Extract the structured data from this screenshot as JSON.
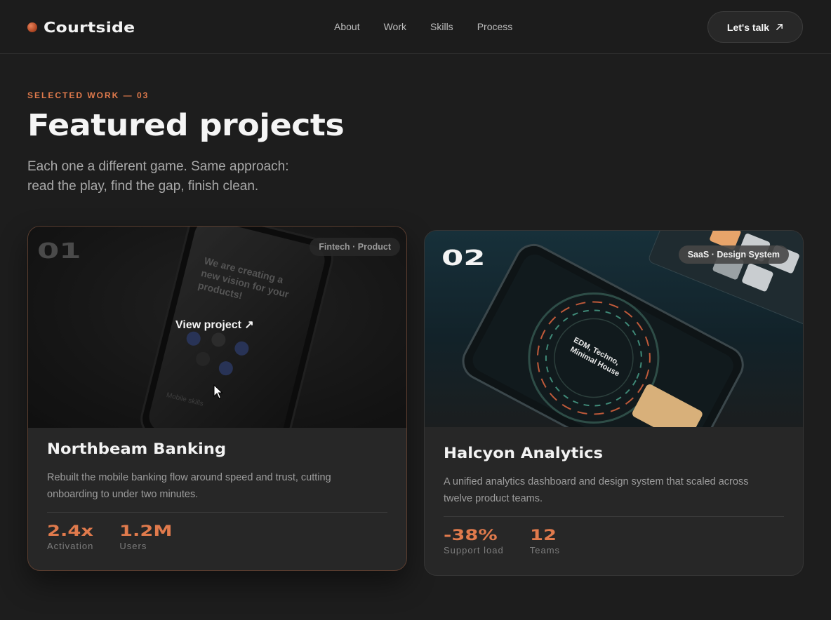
{
  "header": {
    "brand": "Courtside",
    "nav": [
      "About",
      "Work",
      "Skills",
      "Process"
    ],
    "cta_label": "Let's talk"
  },
  "intro": {
    "eyebrow": "SELECTED WORK — 03",
    "title": "Featured projects",
    "lede_line1": "Each one a different game. Same approach:",
    "lede_line2": "read the play, find the gap, finish clean."
  },
  "projects": [
    {
      "number": "01",
      "tag": "Fintech · Product",
      "overlay": "View project ↗",
      "title": "Northbeam Banking",
      "description": "Rebuilt the mobile banking flow around speed and trust, cutting onboarding to under two minutes.",
      "stats": [
        {
          "value": "2.4x",
          "label": "Activation"
        },
        {
          "value": "1.2M",
          "label": "Users"
        }
      ]
    },
    {
      "number": "02",
      "tag": "SaaS · Design System",
      "title": "Halcyon Analytics",
      "description": "A unified analytics dashboard and design system that scaled across twelve product teams.",
      "stats": [
        {
          "value": "-38%",
          "label": "Support load"
        },
        {
          "value": "12",
          "label": "Teams"
        }
      ]
    }
  ],
  "colors": {
    "accent": "#e07a4c",
    "background": "#1d1d1d",
    "card": "#272727"
  }
}
